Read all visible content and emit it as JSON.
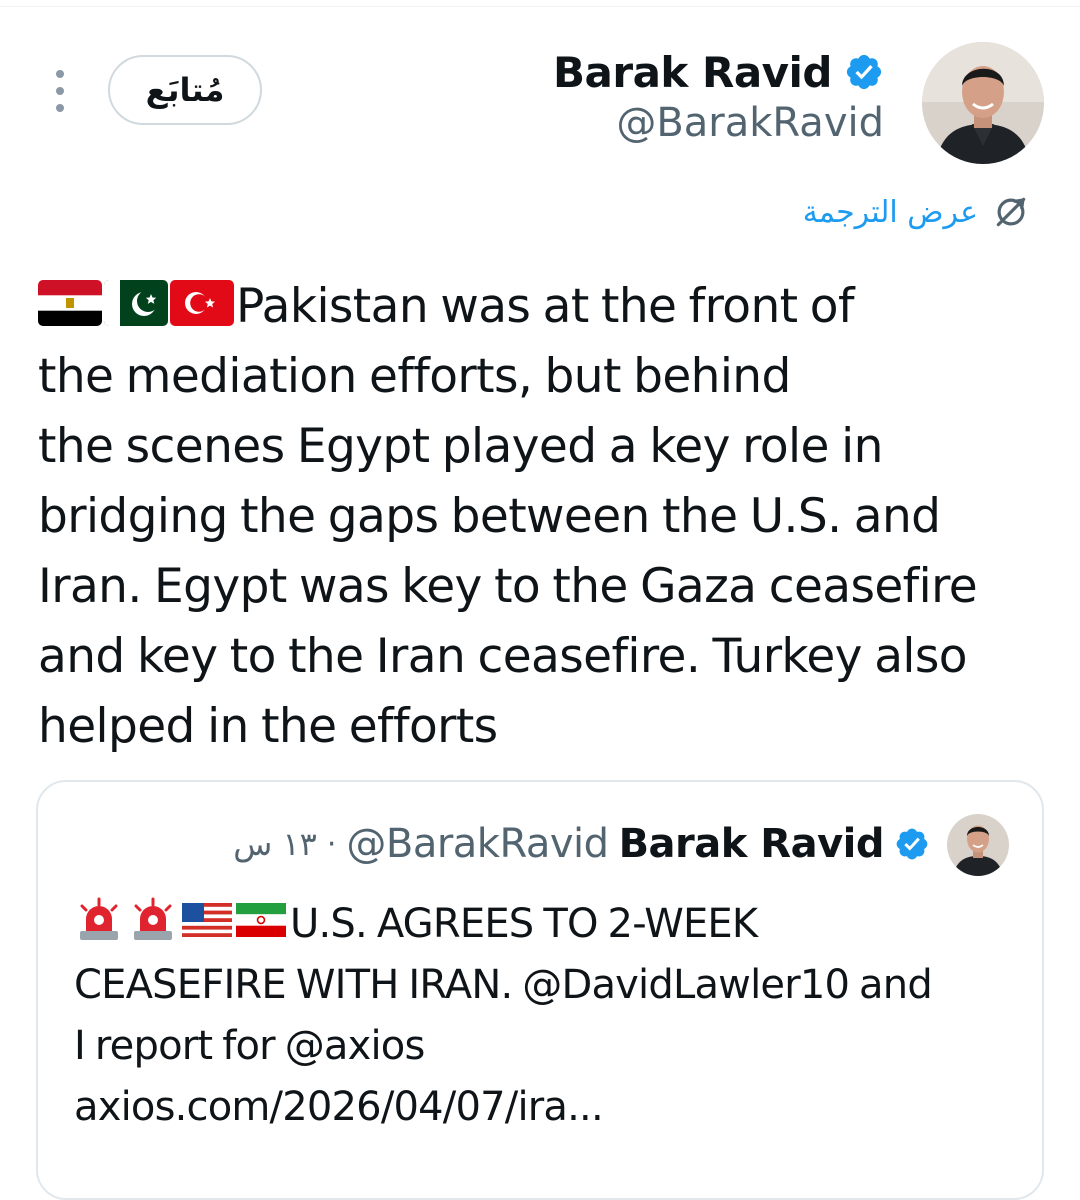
{
  "tweet": {
    "author": {
      "display_name": "Barak Ravid",
      "handle": "@BarakRavid",
      "verified": true,
      "avatar": "profile-photo"
    },
    "follow_label": "مُتابَع",
    "more_icon": "more-vertical-icon",
    "translate_label": "عرض الترجمة",
    "translate_icon": "translate-icon",
    "flags": [
      "egypt-flag",
      "pakistan-flag",
      "turkey-flag"
    ],
    "text_lines": [
      "Pakistan was at the front of",
      "the mediation efforts, but behind",
      "the scenes Egypt played a key role in",
      "bridging the gaps between the U.S. and",
      "Iran. Egypt was key to the Gaza ceasefire",
      "and key to the Iran ceasefire. Turkey also",
      "helped in the efforts"
    ]
  },
  "quoted_tweet": {
    "author": {
      "display_name": "Barak Ravid",
      "handle": "@BarakRavid",
      "verified": true
    },
    "separator": "·",
    "time": "١٣ س",
    "emojis": [
      "siren-emoji",
      "siren-emoji",
      "usa-flag",
      "iran-flag"
    ],
    "text_lines": [
      "U.S. AGREES TO 2-WEEK",
      "CEASEFIRE WITH IRAN. @DavidLawler10 and",
      "I report for @axios",
      "axios.com/2026/04/07/ira..."
    ]
  },
  "colors": {
    "accent": "#1d9bf0",
    "text": "#0f1419",
    "secondary": "#536471",
    "border": "#cfd9de"
  }
}
